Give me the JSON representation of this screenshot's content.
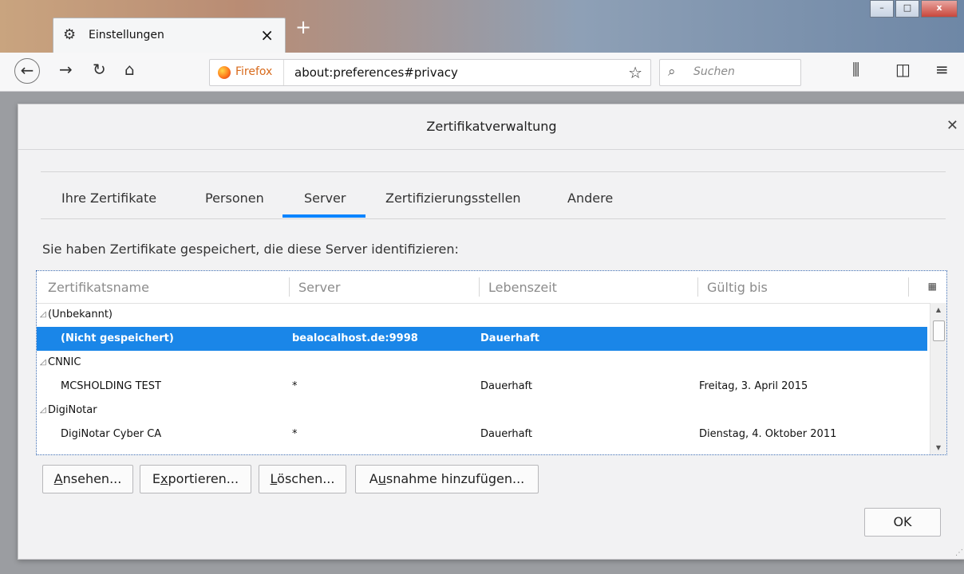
{
  "browser": {
    "tab_title": "Einstellungen",
    "new_tab_label": "+",
    "identity_label": "Firefox",
    "url": "about:preferences#privacy",
    "search_placeholder": "Suchen",
    "window_buttons": [
      "–",
      "□",
      "x"
    ],
    "icons": [
      "gear-icon",
      "close-icon",
      "back-icon",
      "forward-icon",
      "reload-icon",
      "home-icon",
      "firefox-icon",
      "star-icon",
      "search-icon",
      "library-icon",
      "sidebar-icon",
      "menu-icon"
    ]
  },
  "dialog": {
    "title": "Zertifikatverwaltung",
    "tabs": [
      "Ihre Zertifikate",
      "Personen",
      "Server",
      "Zertifizierungsstellen",
      "Andere"
    ],
    "active_tab": "Server",
    "description": "Sie haben Zertifikate gespeichert, die diese Server identifizieren:",
    "columns": [
      "Zertifikatsname",
      "Server",
      "Lebenszeit",
      "Gültig bis"
    ],
    "rows": [
      {
        "type": "group",
        "name": "(Unbekannt)"
      },
      {
        "type": "item",
        "name": "(Nicht gespeichert)",
        "server": "bealocalhost.de:9998",
        "lifetime": "Dauerhaft",
        "valid_until": "",
        "selected": true
      },
      {
        "type": "group",
        "name": "CNNIC"
      },
      {
        "type": "item",
        "name": "MCSHOLDING TEST",
        "server": "*",
        "lifetime": "Dauerhaft",
        "valid_until": "Freitag, 3. April 2015"
      },
      {
        "type": "group",
        "name": "DigiNotar"
      },
      {
        "type": "item",
        "name": "DigiNotar Cyber CA",
        "server": "*",
        "lifetime": "Dauerhaft",
        "valid_until": "Dienstag, 4. Oktober 2011"
      }
    ],
    "buttons": {
      "view": {
        "mn": "A",
        "rest": "nsehen..."
      },
      "export": {
        "pre": "E",
        "mn": "x",
        "rest": "portieren..."
      },
      "delete": {
        "mn": "L",
        "rest": "öschen..."
      },
      "exception": {
        "pre": "A",
        "mn": "u",
        "rest": "snahme hinzufügen..."
      },
      "ok": "OK"
    },
    "accent_color": "#0a84ff",
    "selection_color": "#1a86e8"
  }
}
